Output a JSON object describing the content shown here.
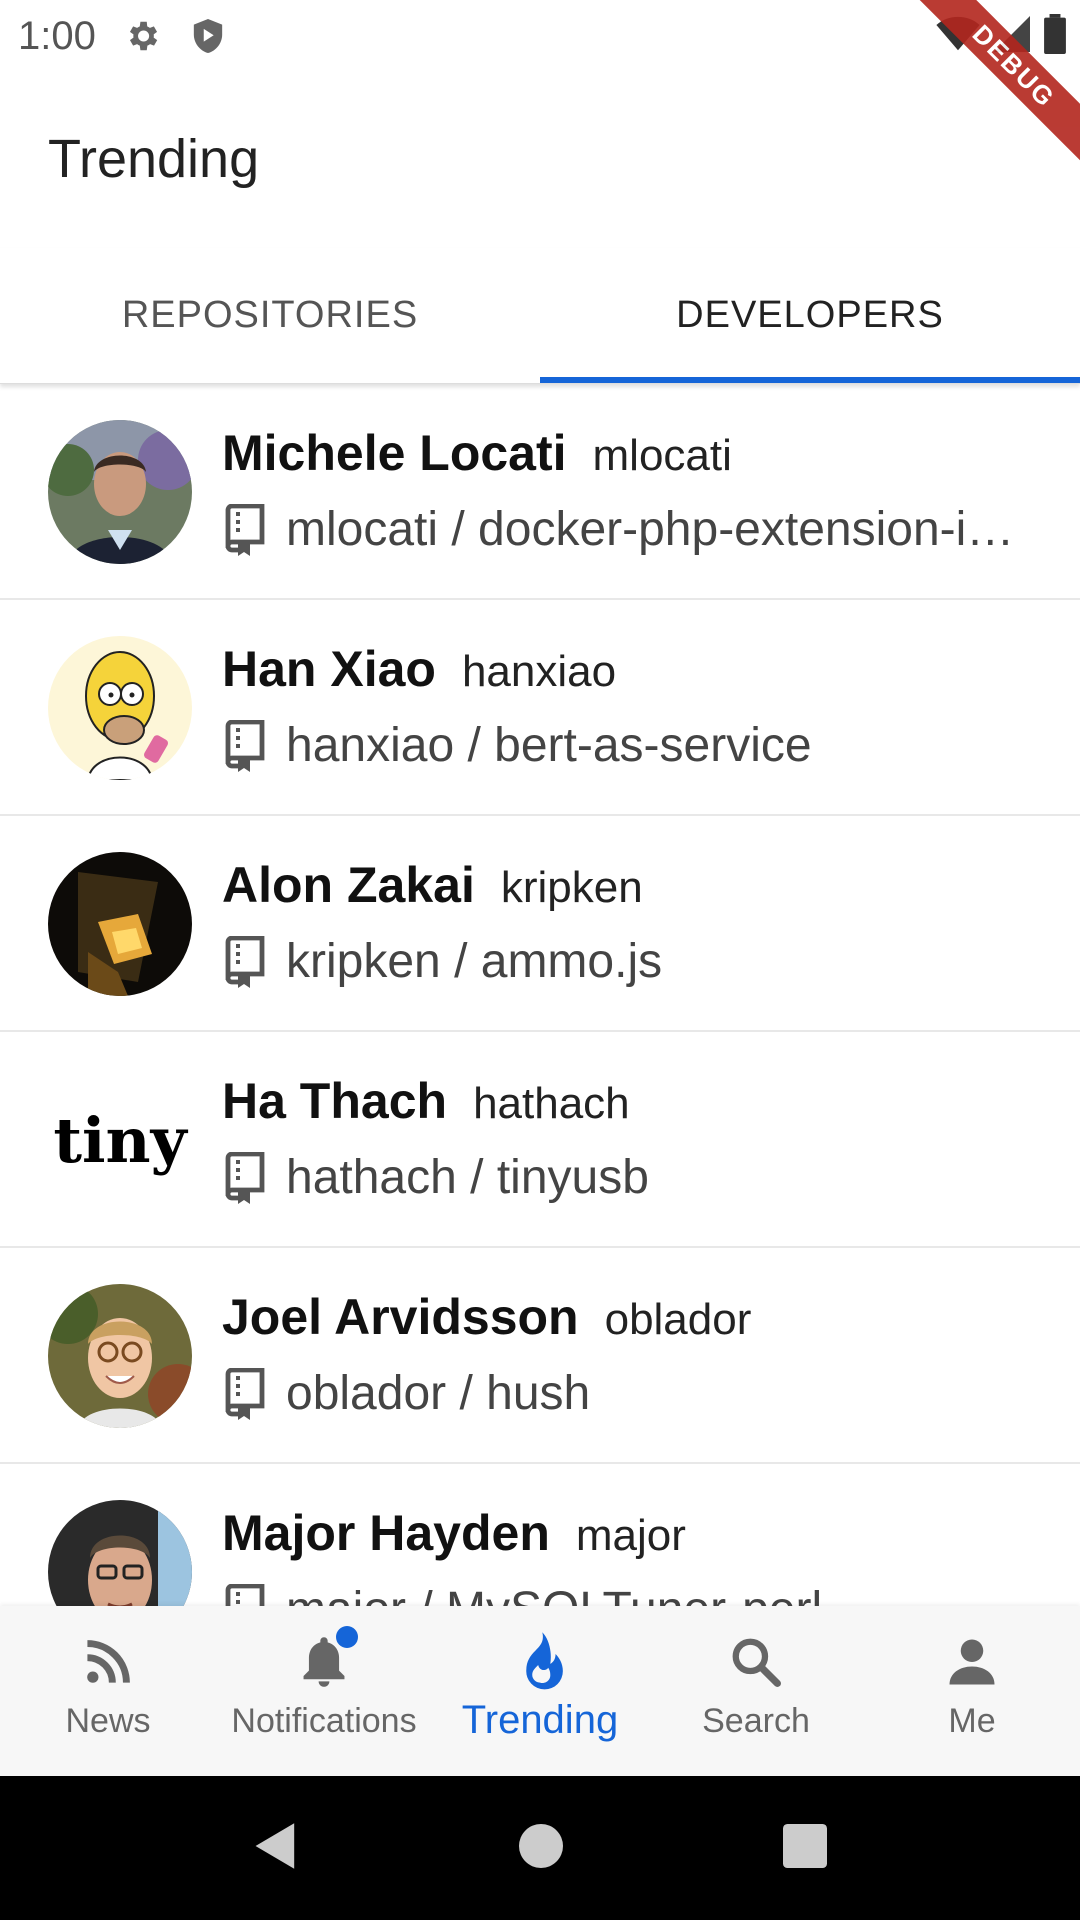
{
  "status_bar": {
    "time": "1:00",
    "icons": [
      "gear-icon",
      "shield-icon",
      "wifi-icon",
      "signal-icon",
      "battery-icon"
    ]
  },
  "debug_banner": "DEBUG",
  "app_bar": {
    "title": "Trending"
  },
  "tabs": [
    {
      "label": "REPOSITORIES",
      "active": false
    },
    {
      "label": "DEVELOPERS",
      "active": true
    }
  ],
  "developers": [
    {
      "name": "Michele Locati",
      "login": "mlocati",
      "repo": "mlocati / docker-php-extension-installer"
    },
    {
      "name": "Han Xiao",
      "login": "hanxiao",
      "repo": "hanxiao / bert-as-service"
    },
    {
      "name": "Alon Zakai",
      "login": "kripken",
      "repo": "kripken / ammo.js"
    },
    {
      "name": "Ha Thach",
      "login": "hathach",
      "repo": "hathach / tinyusb"
    },
    {
      "name": "Joel Arvidsson",
      "login": "oblador",
      "repo": "oblador / hush"
    },
    {
      "name": "Major Hayden",
      "login": "major",
      "repo": "major / MySQLTuner-perl"
    }
  ],
  "avatar_logo_text": "tiny",
  "bottom_nav": [
    {
      "label": "News",
      "icon": "rss-icon"
    },
    {
      "label": "Notifications",
      "icon": "bell-icon"
    },
    {
      "label": "Trending",
      "icon": "flame-icon",
      "active": true
    },
    {
      "label": "Search",
      "icon": "search-icon"
    },
    {
      "label": "Me",
      "icon": "person-icon"
    }
  ],
  "colors": {
    "accent": "#1565d8",
    "debug": "#b3261e"
  }
}
